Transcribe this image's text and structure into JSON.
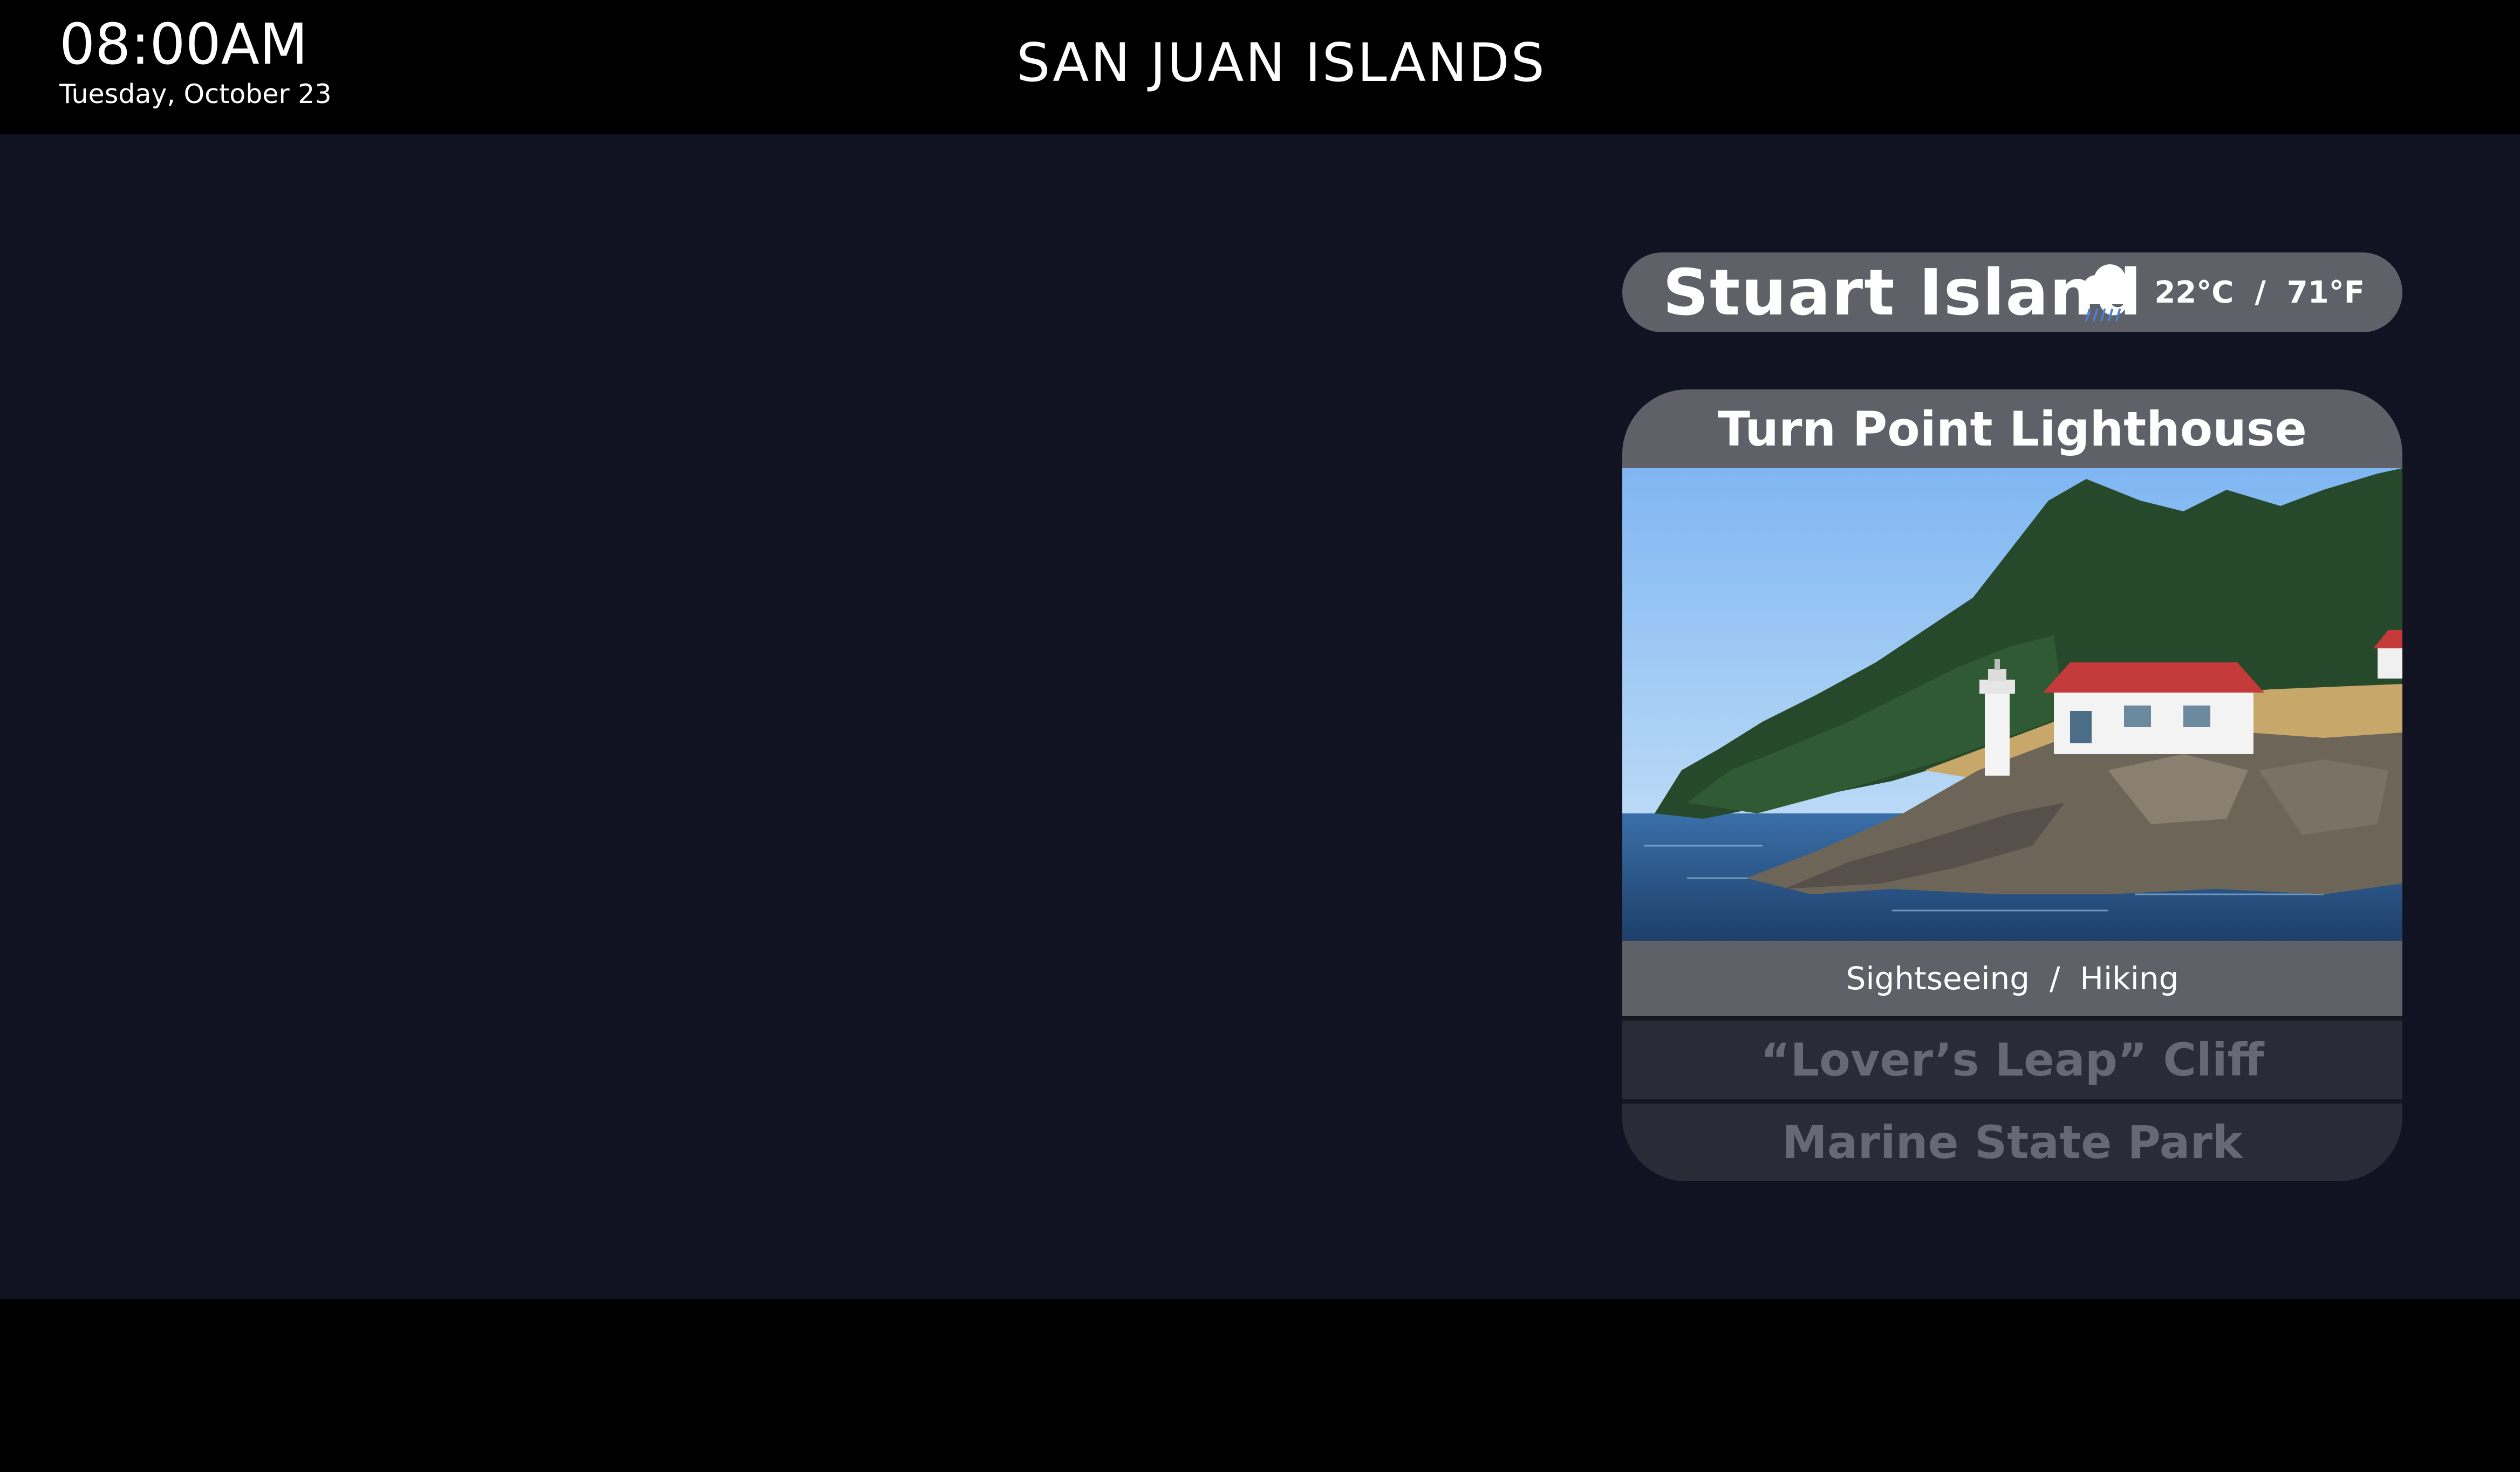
{
  "header": {
    "time": "08:00AM",
    "date": "Tuesday, October 23",
    "title": "SAN JUAN ISLANDS"
  },
  "island": {
    "name": "Stuart Island",
    "weather_icon": "rain-cloud-icon",
    "temperature": "22°C  /  71°F"
  },
  "featured": {
    "title": "Turn Point Lighthouse",
    "photo": "lighthouse-photo",
    "tags": "Sightseeing  /  Hiking"
  },
  "next_items": [
    {
      "label": "“Lover’s Leap” Cliff"
    },
    {
      "label": "Marine State Park"
    }
  ],
  "colors": {
    "background": "#121322",
    "bar": "#000000",
    "pill": "#5f6068",
    "muted_item": "#2a2b36",
    "muted_text": "#676873",
    "rain": "#4a7fd6"
  }
}
